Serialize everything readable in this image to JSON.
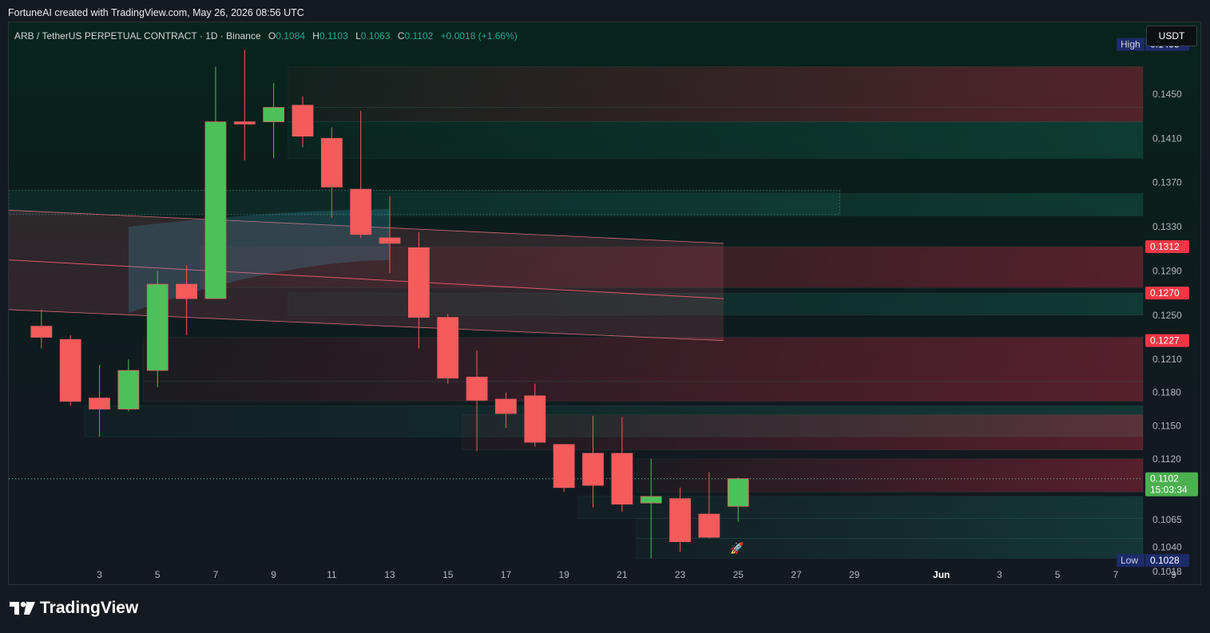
{
  "caption": "FortuneAI created with TradingView.com, May 26, 2026 08:56 UTC",
  "legend": {
    "symbol": "ARB / TetherUS PERPETUAL CONTRACT · 1D · Binance",
    "o_key": "O",
    "o_val": "0.1084",
    "h_key": "H",
    "h_val": "0.1103",
    "l_key": "L",
    "l_val": "0.1063",
    "c_key": "C",
    "c_val": "0.1102",
    "change": "+0.0018 (+1.66%)"
  },
  "currency_button": "USDT",
  "brand": {
    "name": "TradingView",
    "icon": "tradingview-logo-icon"
  },
  "colors": {
    "up": "#4cc15a",
    "down": "#f45b5b",
    "up_border": "#2e7d32",
    "axis_text": "#b2b5be",
    "high_low_bg": "#1c2b6b",
    "price_tag_up": "#4caf50",
    "price_tag_down": "#f23645"
  },
  "chart_data": {
    "type": "candlestick",
    "symbol": "ARB / TetherUS PERPETUAL CONTRACT",
    "interval": "1D",
    "exchange": "Binance",
    "ylim": [
      0.1005,
      0.1515
    ],
    "y_ticks": [
      "0.1450",
      "0.1410",
      "0.1370",
      "0.1330",
      "0.1290",
      "0.1250",
      "0.1210",
      "0.1180",
      "0.1150",
      "0.1120",
      "0.1065",
      "0.1040",
      "0.1018"
    ],
    "x_ticks": [
      {
        "d": 3,
        "label": "3"
      },
      {
        "d": 5,
        "label": "5"
      },
      {
        "d": 7,
        "label": "7"
      },
      {
        "d": 9,
        "label": "9"
      },
      {
        "d": 11,
        "label": "11"
      },
      {
        "d": 13,
        "label": "13"
      },
      {
        "d": 15,
        "label": "15"
      },
      {
        "d": 17,
        "label": "17"
      },
      {
        "d": 19,
        "label": "19"
      },
      {
        "d": 21,
        "label": "21"
      },
      {
        "d": 23,
        "label": "23"
      },
      {
        "d": 25,
        "label": "25"
      },
      {
        "d": 27,
        "label": "27"
      },
      {
        "d": 29,
        "label": "29"
      },
      {
        "d": 32,
        "label": "Jun",
        "bold": true
      },
      {
        "d": 34,
        "label": "3"
      },
      {
        "d": 36,
        "label": "5"
      },
      {
        "d": 38,
        "label": "7"
      },
      {
        "d": 40,
        "label": "9"
      }
    ],
    "candles": [
      {
        "d": 1,
        "o": 0.124,
        "h": 0.1255,
        "l": 0.122,
        "c": 0.123
      },
      {
        "d": 2,
        "o": 0.1228,
        "h": 0.1232,
        "l": 0.1168,
        "c": 0.1172
      },
      {
        "d": 3,
        "o": 0.1175,
        "h": 0.1205,
        "l": 0.114,
        "c": 0.1165
      },
      {
        "d": 4,
        "o": 0.1165,
        "h": 0.121,
        "l": 0.1163,
        "c": 0.12
      },
      {
        "d": 5,
        "o": 0.12,
        "h": 0.129,
        "l": 0.1185,
        "c": 0.1278
      },
      {
        "d": 6,
        "o": 0.1278,
        "h": 0.1295,
        "l": 0.1232,
        "c": 0.1265
      },
      {
        "d": 7,
        "o": 0.1265,
        "h": 0.1475,
        "l": 0.1265,
        "c": 0.1425
      },
      {
        "d": 8,
        "o": 0.1425,
        "h": 0.149,
        "l": 0.139,
        "c": 0.1423
      },
      {
        "d": 9,
        "o": 0.1425,
        "h": 0.146,
        "l": 0.1392,
        "c": 0.1438
      },
      {
        "d": 10,
        "o": 0.144,
        "h": 0.1448,
        "l": 0.1402,
        "c": 0.1412
      },
      {
        "d": 11,
        "o": 0.141,
        "h": 0.142,
        "l": 0.1338,
        "c": 0.1366
      },
      {
        "d": 12,
        "o": 0.1364,
        "h": 0.1435,
        "l": 0.132,
        "c": 0.1323
      },
      {
        "d": 13,
        "o": 0.132,
        "h": 0.1358,
        "l": 0.1288,
        "c": 0.1315
      },
      {
        "d": 14,
        "o": 0.1311,
        "h": 0.1325,
        "l": 0.122,
        "c": 0.1248
      },
      {
        "d": 15,
        "o": 0.1248,
        "h": 0.1251,
        "l": 0.1188,
        "c": 0.1193
      },
      {
        "d": 16,
        "o": 0.1194,
        "h": 0.1218,
        "l": 0.1127,
        "c": 0.1173
      },
      {
        "d": 17,
        "o": 0.1174,
        "h": 0.118,
        "l": 0.1148,
        "c": 0.1161
      },
      {
        "d": 18,
        "o": 0.1177,
        "h": 0.1188,
        "l": 0.1131,
        "c": 0.1135
      },
      {
        "d": 19,
        "o": 0.1133,
        "h": 0.1133,
        "l": 0.109,
        "c": 0.1094
      },
      {
        "d": 20,
        "o": 0.1125,
        "h": 0.1159,
        "l": 0.1076,
        "c": 0.1096
      },
      {
        "d": 21,
        "o": 0.1125,
        "h": 0.1158,
        "l": 0.1072,
        "c": 0.1079
      },
      {
        "d": 22,
        "o": 0.108,
        "h": 0.112,
        "l": 0.103,
        "c": 0.1086
      },
      {
        "d": 23,
        "o": 0.1084,
        "h": 0.1094,
        "l": 0.1036,
        "c": 0.1045
      },
      {
        "d": 24,
        "o": 0.107,
        "h": 0.1108,
        "l": 0.1048,
        "c": 0.1049
      },
      {
        "d": 25,
        "o": 0.1077,
        "h": 0.1103,
        "l": 0.1063,
        "c": 0.1102
      }
    ],
    "markers": {
      "high": {
        "label": "High",
        "value": "0.1495"
      },
      "low": {
        "label": "Low",
        "value": "0.1028"
      },
      "last": {
        "value": "0.1102",
        "countdown": "15:03:34"
      },
      "levels": [
        "0.1312",
        "0.1270",
        "0.1227"
      ]
    },
    "grid": false
  }
}
